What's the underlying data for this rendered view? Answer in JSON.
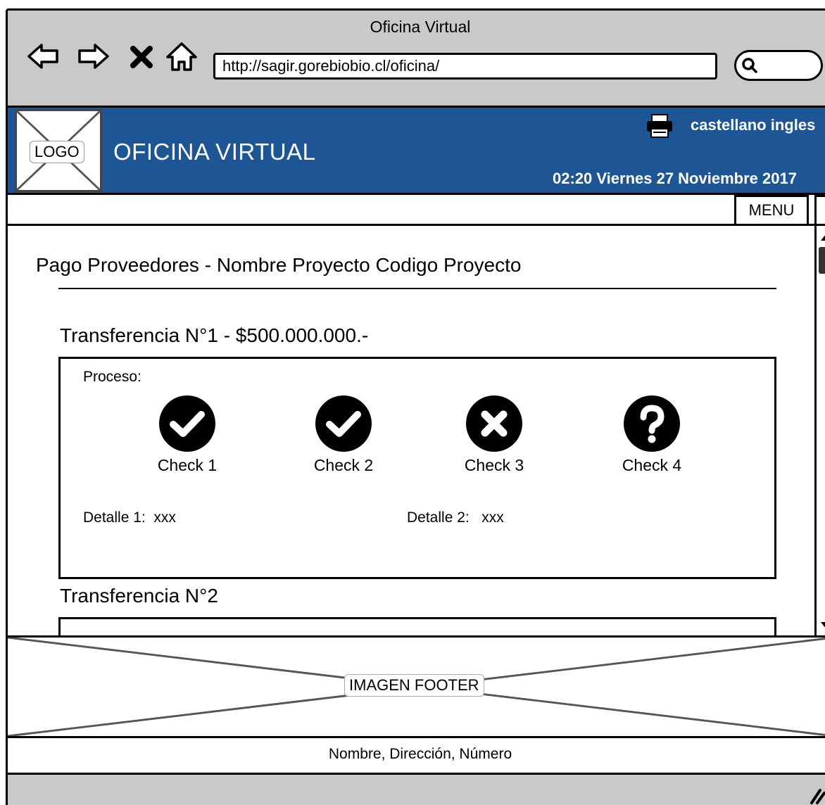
{
  "browser": {
    "window_title": "Oficina Virtual",
    "url": "http://sagir.gorebiobio.cl/oficina/"
  },
  "header": {
    "logo_label": "LOGO",
    "site_title": "OFICINA VIRTUAL",
    "lang_es": "castellano",
    "lang_en": "ingles",
    "datetime": "02:20 Viernes 27 Noviembre 2017",
    "brand_color": "#1e5594"
  },
  "menu": {
    "label": "MENU"
  },
  "page": {
    "title": "Pago Proveedores - Nombre Proyecto Codigo Proyecto"
  },
  "transfers": [
    {
      "title": "Transferencia N°1 - $500.000.000.-",
      "proceso_label": "Proceso:",
      "checks": [
        {
          "label": "Check 1",
          "icon": "check-circle-icon"
        },
        {
          "label": "Check 2",
          "icon": "check-circle-icon"
        },
        {
          "label": "Check 3",
          "icon": "x-circle-icon"
        },
        {
          "label": "Check 4",
          "icon": "question-circle-icon"
        }
      ],
      "details": [
        {
          "label": "Detalle 1:",
          "value": "xxx"
        },
        {
          "label": "Detalle 2:",
          "value": "xxx"
        }
      ]
    },
    {
      "title": "Transferencia N°2"
    }
  ],
  "footer": {
    "image_label": "IMAGEN FOOTER",
    "text": "Nombre, Dirección, Número"
  }
}
